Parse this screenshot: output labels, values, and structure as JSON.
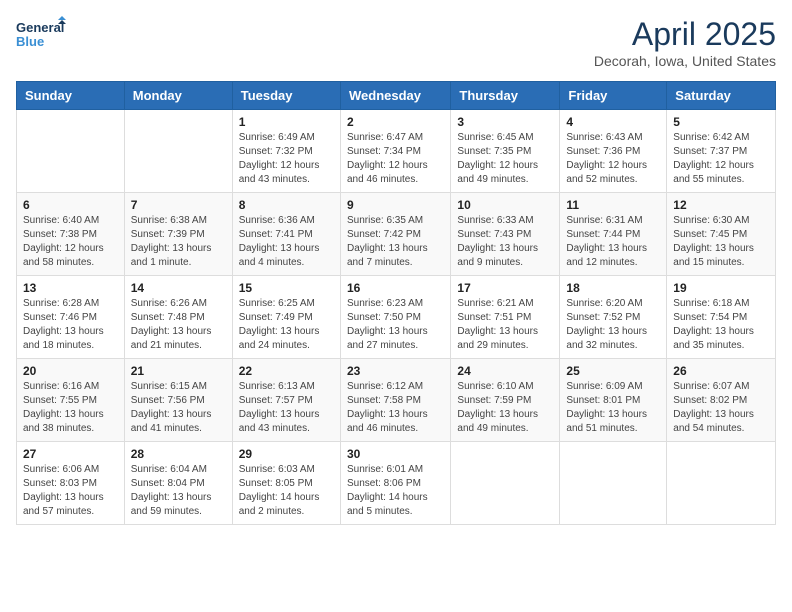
{
  "logo": {
    "line1": "General",
    "line2": "Blue"
  },
  "title": "April 2025",
  "subtitle": "Decorah, Iowa, United States",
  "days_header": [
    "Sunday",
    "Monday",
    "Tuesday",
    "Wednesday",
    "Thursday",
    "Friday",
    "Saturday"
  ],
  "weeks": [
    [
      {
        "day": "",
        "info": ""
      },
      {
        "day": "",
        "info": ""
      },
      {
        "day": "1",
        "info": "Sunrise: 6:49 AM\nSunset: 7:32 PM\nDaylight: 12 hours and 43 minutes."
      },
      {
        "day": "2",
        "info": "Sunrise: 6:47 AM\nSunset: 7:34 PM\nDaylight: 12 hours and 46 minutes."
      },
      {
        "day": "3",
        "info": "Sunrise: 6:45 AM\nSunset: 7:35 PM\nDaylight: 12 hours and 49 minutes."
      },
      {
        "day": "4",
        "info": "Sunrise: 6:43 AM\nSunset: 7:36 PM\nDaylight: 12 hours and 52 minutes."
      },
      {
        "day": "5",
        "info": "Sunrise: 6:42 AM\nSunset: 7:37 PM\nDaylight: 12 hours and 55 minutes."
      }
    ],
    [
      {
        "day": "6",
        "info": "Sunrise: 6:40 AM\nSunset: 7:38 PM\nDaylight: 12 hours and 58 minutes."
      },
      {
        "day": "7",
        "info": "Sunrise: 6:38 AM\nSunset: 7:39 PM\nDaylight: 13 hours and 1 minute."
      },
      {
        "day": "8",
        "info": "Sunrise: 6:36 AM\nSunset: 7:41 PM\nDaylight: 13 hours and 4 minutes."
      },
      {
        "day": "9",
        "info": "Sunrise: 6:35 AM\nSunset: 7:42 PM\nDaylight: 13 hours and 7 minutes."
      },
      {
        "day": "10",
        "info": "Sunrise: 6:33 AM\nSunset: 7:43 PM\nDaylight: 13 hours and 9 minutes."
      },
      {
        "day": "11",
        "info": "Sunrise: 6:31 AM\nSunset: 7:44 PM\nDaylight: 13 hours and 12 minutes."
      },
      {
        "day": "12",
        "info": "Sunrise: 6:30 AM\nSunset: 7:45 PM\nDaylight: 13 hours and 15 minutes."
      }
    ],
    [
      {
        "day": "13",
        "info": "Sunrise: 6:28 AM\nSunset: 7:46 PM\nDaylight: 13 hours and 18 minutes."
      },
      {
        "day": "14",
        "info": "Sunrise: 6:26 AM\nSunset: 7:48 PM\nDaylight: 13 hours and 21 minutes."
      },
      {
        "day": "15",
        "info": "Sunrise: 6:25 AM\nSunset: 7:49 PM\nDaylight: 13 hours and 24 minutes."
      },
      {
        "day": "16",
        "info": "Sunrise: 6:23 AM\nSunset: 7:50 PM\nDaylight: 13 hours and 27 minutes."
      },
      {
        "day": "17",
        "info": "Sunrise: 6:21 AM\nSunset: 7:51 PM\nDaylight: 13 hours and 29 minutes."
      },
      {
        "day": "18",
        "info": "Sunrise: 6:20 AM\nSunset: 7:52 PM\nDaylight: 13 hours and 32 minutes."
      },
      {
        "day": "19",
        "info": "Sunrise: 6:18 AM\nSunset: 7:54 PM\nDaylight: 13 hours and 35 minutes."
      }
    ],
    [
      {
        "day": "20",
        "info": "Sunrise: 6:16 AM\nSunset: 7:55 PM\nDaylight: 13 hours and 38 minutes."
      },
      {
        "day": "21",
        "info": "Sunrise: 6:15 AM\nSunset: 7:56 PM\nDaylight: 13 hours and 41 minutes."
      },
      {
        "day": "22",
        "info": "Sunrise: 6:13 AM\nSunset: 7:57 PM\nDaylight: 13 hours and 43 minutes."
      },
      {
        "day": "23",
        "info": "Sunrise: 6:12 AM\nSunset: 7:58 PM\nDaylight: 13 hours and 46 minutes."
      },
      {
        "day": "24",
        "info": "Sunrise: 6:10 AM\nSunset: 7:59 PM\nDaylight: 13 hours and 49 minutes."
      },
      {
        "day": "25",
        "info": "Sunrise: 6:09 AM\nSunset: 8:01 PM\nDaylight: 13 hours and 51 minutes."
      },
      {
        "day": "26",
        "info": "Sunrise: 6:07 AM\nSunset: 8:02 PM\nDaylight: 13 hours and 54 minutes."
      }
    ],
    [
      {
        "day": "27",
        "info": "Sunrise: 6:06 AM\nSunset: 8:03 PM\nDaylight: 13 hours and 57 minutes."
      },
      {
        "day": "28",
        "info": "Sunrise: 6:04 AM\nSunset: 8:04 PM\nDaylight: 13 hours and 59 minutes."
      },
      {
        "day": "29",
        "info": "Sunrise: 6:03 AM\nSunset: 8:05 PM\nDaylight: 14 hours and 2 minutes."
      },
      {
        "day": "30",
        "info": "Sunrise: 6:01 AM\nSunset: 8:06 PM\nDaylight: 14 hours and 5 minutes."
      },
      {
        "day": "",
        "info": ""
      },
      {
        "day": "",
        "info": ""
      },
      {
        "day": "",
        "info": ""
      }
    ]
  ]
}
